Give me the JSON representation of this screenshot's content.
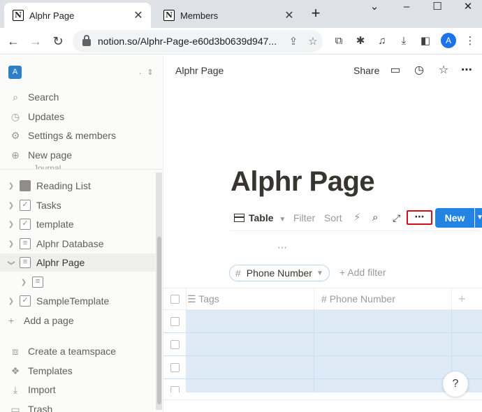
{
  "browser": {
    "tabs": [
      {
        "title": "Alphr Page",
        "favicon": "N"
      },
      {
        "title": "Members",
        "favicon": "N"
      }
    ],
    "url": "notion.so/Alphr-Page-e60d3b0639d947...",
    "profile_initial": "A"
  },
  "sidebar": {
    "workspace_initial": "A",
    "workspace_name": ".",
    "top_items": [
      {
        "label": "Search",
        "icon": "search-icon"
      },
      {
        "label": "Updates",
        "icon": "clock-icon"
      },
      {
        "label": "Settings & members",
        "icon": "gear-icon"
      },
      {
        "label": "New page",
        "icon": "plus-circle-icon"
      }
    ],
    "peek_label": "Journal",
    "tree": [
      {
        "label": "Reading List",
        "icon": "book-icon"
      },
      {
        "label": "Tasks",
        "icon": "checkbox-icon"
      },
      {
        "label": "template",
        "icon": "checkbox-icon"
      },
      {
        "label": "Alphr Database",
        "icon": "page-icon"
      },
      {
        "label": "Alphr Page",
        "icon": "page-icon"
      },
      {
        "label": "",
        "icon": "page-icon"
      },
      {
        "label": "SampleTemplate",
        "icon": "checkbox-icon"
      }
    ],
    "add_page_label": "Add a page",
    "bottom_items": [
      {
        "label": "Create a teamspace",
        "icon": "teamspace-icon"
      },
      {
        "label": "Templates",
        "icon": "templates-icon"
      },
      {
        "label": "Import",
        "icon": "import-icon"
      },
      {
        "label": "Trash",
        "icon": "trash-icon"
      }
    ]
  },
  "main": {
    "breadcrumb": "Alphr Page",
    "share_label": "Share",
    "title": "Alphr Page",
    "view": {
      "table_label": "Table",
      "filter_label": "Filter",
      "sort_label": "Sort",
      "new_label": "New"
    },
    "filter_pill_label": "Phone Number",
    "add_filter_label": "Add filter",
    "columns": [
      "Tags",
      "Phone Number"
    ],
    "help_label": "?"
  }
}
